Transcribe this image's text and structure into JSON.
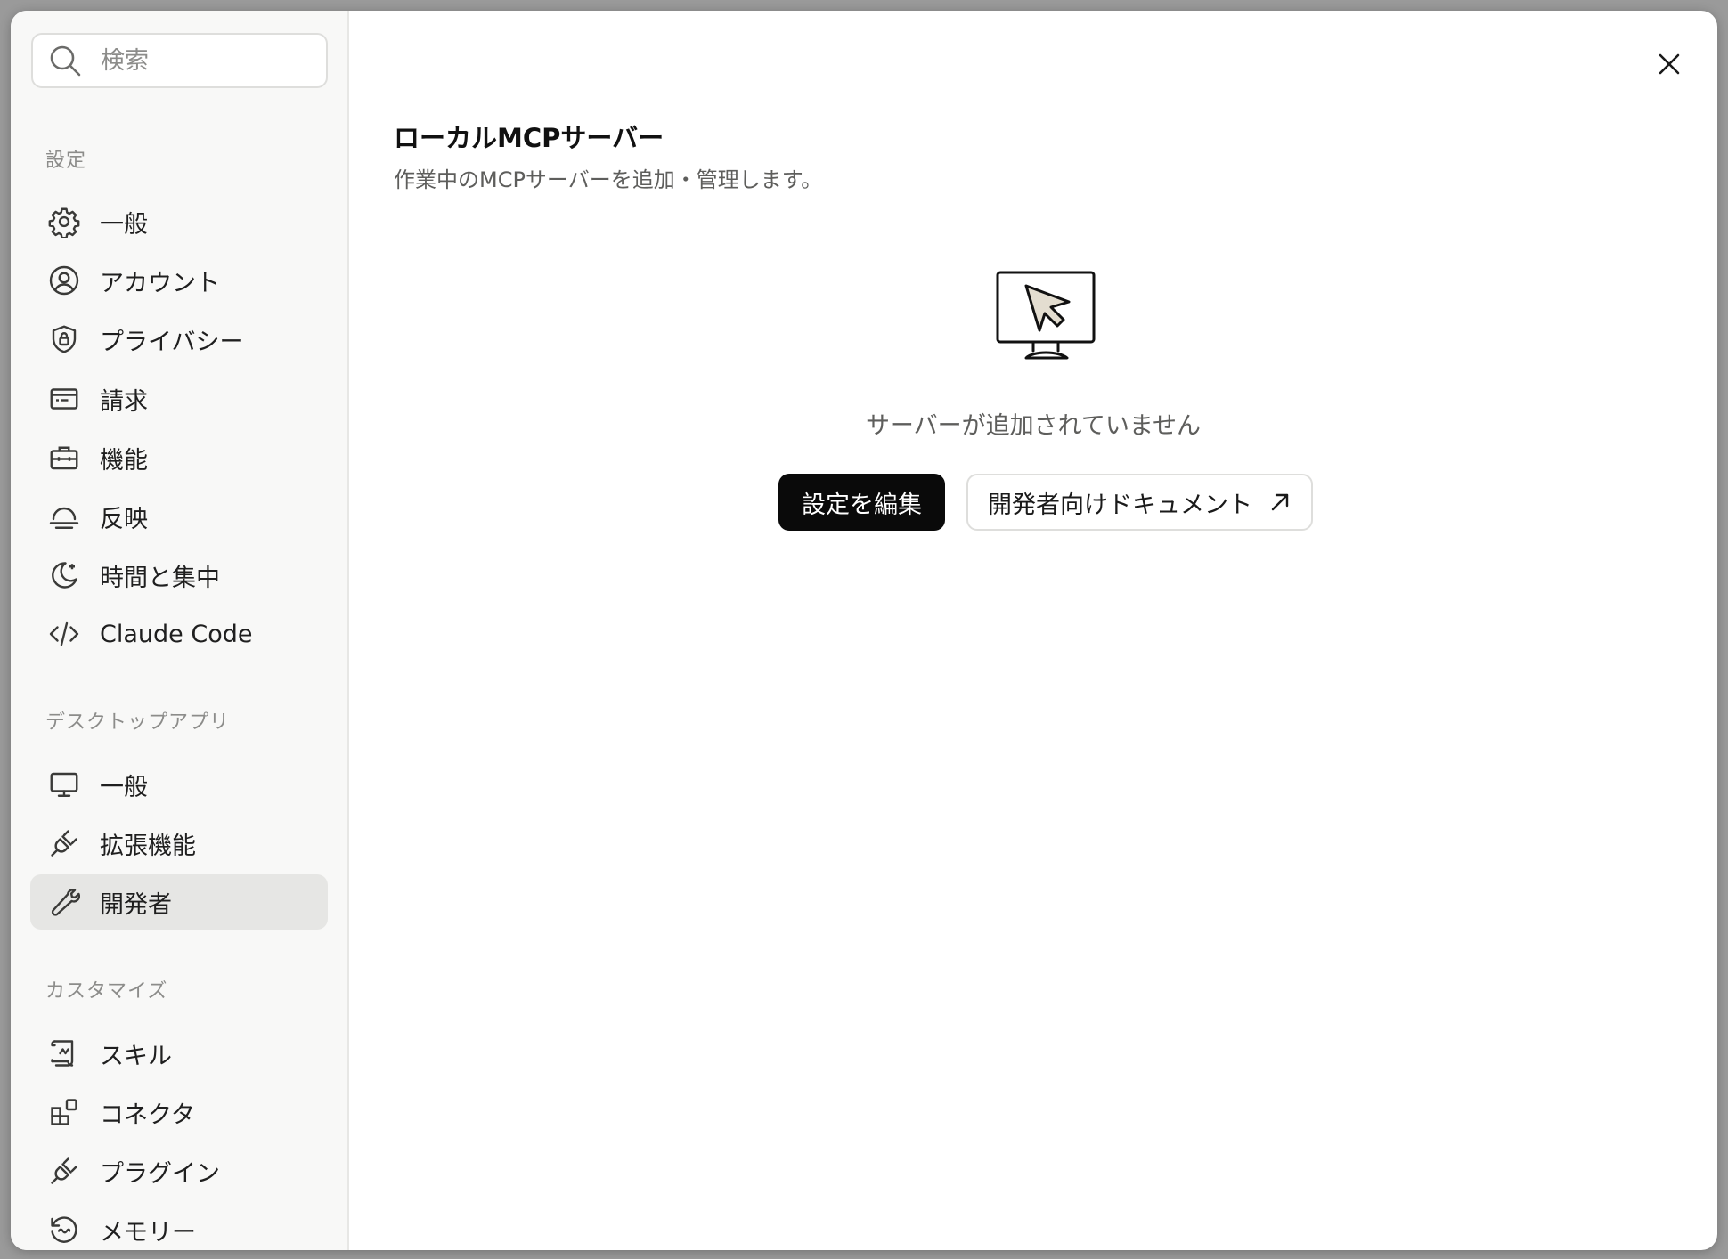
{
  "search": {
    "placeholder": "検索"
  },
  "sidebar": {
    "sections": [
      {
        "label": "設定",
        "items": [
          {
            "label": "一般",
            "icon": "gear-icon"
          },
          {
            "label": "アカウント",
            "icon": "user-circle-icon"
          },
          {
            "label": "プライバシー",
            "icon": "shield-lock-icon"
          },
          {
            "label": "請求",
            "icon": "credit-card-icon"
          },
          {
            "label": "機能",
            "icon": "briefcase-icon"
          },
          {
            "label": "反映",
            "icon": "sunset-icon"
          },
          {
            "label": "時間と集中",
            "icon": "moon-sparkle-icon"
          },
          {
            "label": "Claude Code",
            "icon": "code-icon"
          }
        ]
      },
      {
        "label": "デスクトップアプリ",
        "items": [
          {
            "label": "一般",
            "icon": "monitor-icon"
          },
          {
            "label": "拡張機能",
            "icon": "plug-icon"
          },
          {
            "label": "開発者",
            "icon": "wrench-icon",
            "active": true
          }
        ]
      },
      {
        "label": "カスタマイズ",
        "items": [
          {
            "label": "スキル",
            "icon": "scroll-icon"
          },
          {
            "label": "コネクタ",
            "icon": "blocks-icon"
          },
          {
            "label": "プラグイン",
            "icon": "plug-icon"
          },
          {
            "label": "メモリー",
            "icon": "history-icon"
          }
        ]
      }
    ]
  },
  "main": {
    "title": "ローカルMCPサーバー",
    "subtitle": "作業中のMCPサーバーを追加・管理します。",
    "empty_state": "サーバーが追加されていません",
    "edit_config_label": "設定を編集",
    "dev_docs_label": "開発者向けドキュメント"
  },
  "colors": {
    "accent": "#0a0a0a",
    "active_bg": "#e6e6e4",
    "sidebar_bg": "#f8f8f7"
  }
}
